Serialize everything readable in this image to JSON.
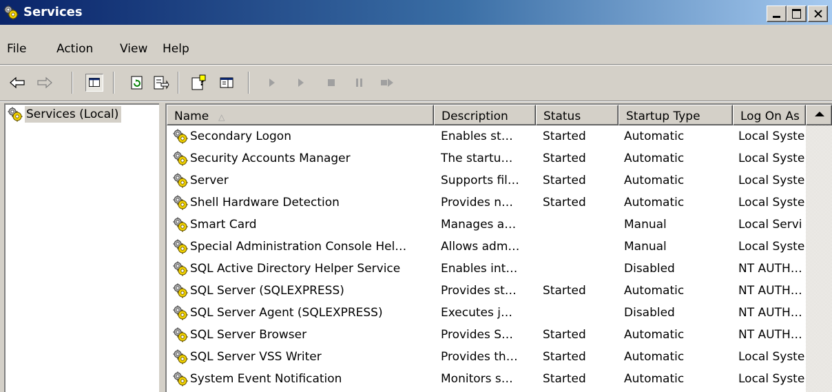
{
  "window": {
    "title": "Services"
  },
  "menu": [
    "File",
    "Action",
    "View",
    "Help"
  ],
  "toolbar": [
    "back-icon",
    "forward-icon",
    "show-hide-tree-icon",
    "refresh-icon",
    "export-list-icon",
    "help-icon",
    "properties-icon",
    "start-service-icon",
    "resume-service-icon",
    "stop-service-icon",
    "pause-service-icon",
    "restart-service-icon"
  ],
  "tree": {
    "root": "Services (Local)"
  },
  "list": {
    "columns": [
      "Name",
      "Description",
      "Status",
      "Startup Type",
      "Log On As"
    ],
    "sort_indicator": "△",
    "rows": [
      {
        "name": "Secondary Logon",
        "desc": "Enables st…",
        "status": "Started",
        "startup": "Automatic",
        "logon": "Local Syste"
      },
      {
        "name": "Security Accounts Manager",
        "desc": "The startu…",
        "status": "Started",
        "startup": "Automatic",
        "logon": "Local Syste"
      },
      {
        "name": "Server",
        "desc": "Supports fil…",
        "status": "Started",
        "startup": "Automatic",
        "logon": "Local Syste"
      },
      {
        "name": "Shell Hardware Detection",
        "desc": "Provides n…",
        "status": "Started",
        "startup": "Automatic",
        "logon": "Local Syste"
      },
      {
        "name": "Smart Card",
        "desc": "Manages a…",
        "status": "",
        "startup": "Manual",
        "logon": "Local Servi"
      },
      {
        "name": "Special Administration Console Hel…",
        "desc": "Allows adm…",
        "status": "",
        "startup": "Manual",
        "logon": "Local Syste"
      },
      {
        "name": "SQL Active Directory Helper Service",
        "desc": "Enables int…",
        "status": "",
        "startup": "Disabled",
        "logon": "NT AUTH…"
      },
      {
        "name": "SQL Server (SQLEXPRESS)",
        "desc": "Provides st…",
        "status": "Started",
        "startup": "Automatic",
        "logon": "NT AUTH…"
      },
      {
        "name": "SQL Server Agent (SQLEXPRESS)",
        "desc": "Executes j…",
        "status": "",
        "startup": "Disabled",
        "logon": "NT AUTH…"
      },
      {
        "name": "SQL Server Browser",
        "desc": "Provides S…",
        "status": "Started",
        "startup": "Automatic",
        "logon": "NT AUTH…"
      },
      {
        "name": "SQL Server VSS Writer",
        "desc": "Provides th…",
        "status": "Started",
        "startup": "Automatic",
        "logon": "Local Syste"
      },
      {
        "name": "System Event Notification",
        "desc": "Monitors s…",
        "status": "Started",
        "startup": "Automatic",
        "logon": "Local Syste"
      }
    ]
  }
}
